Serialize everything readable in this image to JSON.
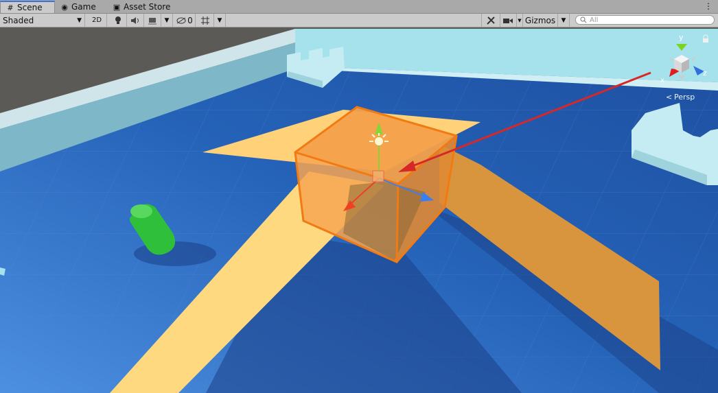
{
  "tabs": [
    {
      "label": "Scene",
      "icon": "grid-icon",
      "active": true
    },
    {
      "label": "Game",
      "icon": "gamepad-icon",
      "active": false
    },
    {
      "label": "Asset Store",
      "icon": "shopping-bag-icon",
      "active": false
    }
  ],
  "toolbar": {
    "draw_mode": "Shaded",
    "mode_2d": "2D",
    "hidden_count": "0",
    "gizmos": "Gizmos",
    "search_placeholder": "All"
  },
  "orientation_gizmo": {
    "y_label": "y",
    "x_label": "x",
    "z_label": "z",
    "persp_label": "Persp"
  },
  "colors": {
    "ground": "#2462b8",
    "wall": "#a6e2ec",
    "selection": "#f27a12",
    "planks": "#ffd27a",
    "capsule": "#2fbf3a",
    "annotation_arrow": "#d62828"
  }
}
